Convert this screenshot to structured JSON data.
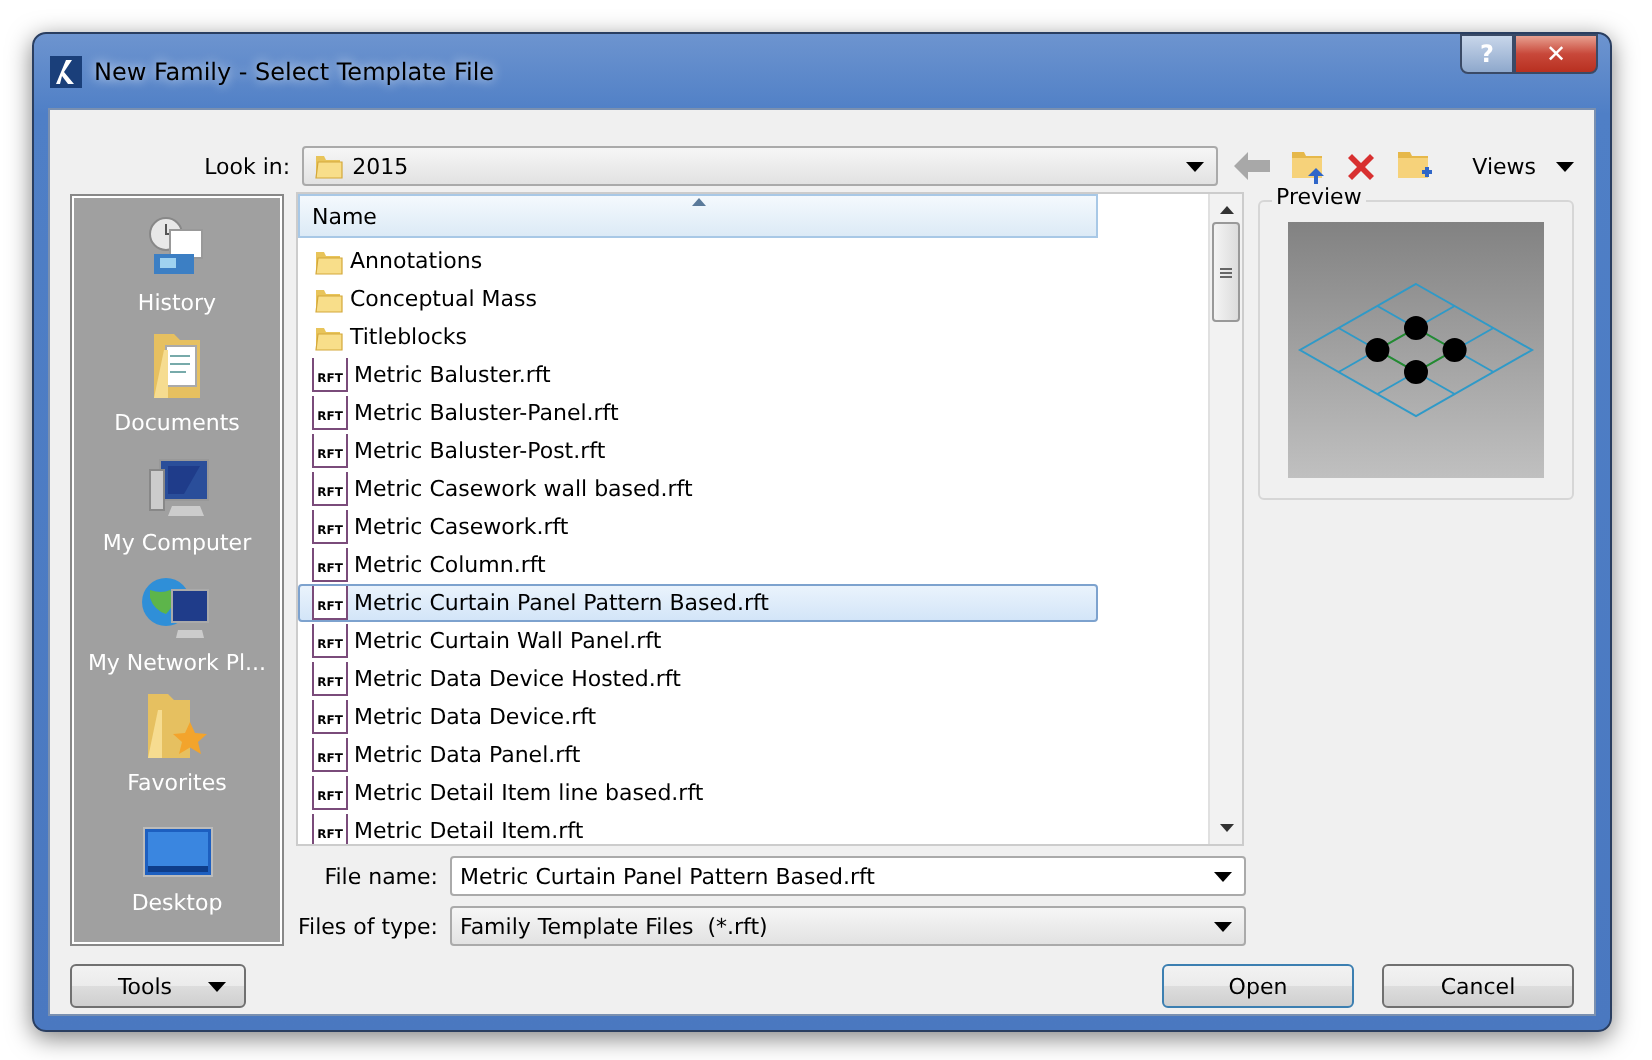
{
  "window": {
    "title": "New Family - Select Template File"
  },
  "title_buttons": [
    {
      "label": "?",
      "kind": "help"
    },
    {
      "label": "✕",
      "kind": "close"
    }
  ],
  "look_in": {
    "label": "Look in:",
    "value": "2015"
  },
  "toolbar": {
    "views_label": "Views"
  },
  "places": [
    {
      "label": "History",
      "kind": "history"
    },
    {
      "label": "Documents",
      "kind": "documents"
    },
    {
      "label": "My Computer",
      "kind": "computer"
    },
    {
      "label": "My Network Pl...",
      "kind": "network"
    },
    {
      "label": "Favorites",
      "kind": "favorites"
    },
    {
      "label": "Desktop",
      "kind": "desktop"
    }
  ],
  "file_list": {
    "column": "Name",
    "items": [
      {
        "name": "Annotations",
        "kind": "folder",
        "selected": false
      },
      {
        "name": "Conceptual Mass",
        "kind": "folder",
        "selected": false
      },
      {
        "name": "Titleblocks",
        "kind": "folder",
        "selected": false
      },
      {
        "name": "Metric Baluster.rft",
        "kind": "file",
        "icon_text": "RFT",
        "selected": false
      },
      {
        "name": "Metric Baluster-Panel.rft",
        "kind": "file",
        "icon_text": "RFT",
        "selected": false
      },
      {
        "name": "Metric Baluster-Post.rft",
        "kind": "file",
        "icon_text": "RFT",
        "selected": false
      },
      {
        "name": "Metric Casework wall based.rft",
        "kind": "file",
        "icon_text": "RFT",
        "selected": false
      },
      {
        "name": "Metric Casework.rft",
        "kind": "file",
        "icon_text": "RFT",
        "selected": false
      },
      {
        "name": "Metric Column.rft",
        "kind": "file",
        "icon_text": "RFT",
        "selected": false
      },
      {
        "name": "Metric Curtain Panel Pattern Based.rft",
        "kind": "file",
        "icon_text": "RFT",
        "selected": true
      },
      {
        "name": "Metric Curtain Wall Panel.rft",
        "kind": "file",
        "icon_text": "RFT",
        "selected": false
      },
      {
        "name": "Metric Data Device Hosted.rft",
        "kind": "file",
        "icon_text": "RFT",
        "selected": false
      },
      {
        "name": "Metric Data Device.rft",
        "kind": "file",
        "icon_text": "RFT",
        "selected": false
      },
      {
        "name": "Metric Data Panel.rft",
        "kind": "file",
        "icon_text": "RFT",
        "selected": false
      },
      {
        "name": "Metric Detail Item line based.rft",
        "kind": "file",
        "icon_text": "RFT",
        "selected": false
      },
      {
        "name": "Metric Detail Item.rft",
        "kind": "file",
        "icon_text": "RFT",
        "selected": false
      }
    ]
  },
  "preview": {
    "label": "Preview"
  },
  "file_name": {
    "label": "File name:",
    "value": "Metric Curtain Panel Pattern Based.rft"
  },
  "file_type": {
    "label": "Files of type:",
    "value": "Family Template Files  (*.rft)"
  },
  "buttons": [
    {
      "label": "Tools",
      "kind": "menu"
    },
    {
      "label": "Open",
      "kind": "default"
    },
    {
      "label": "Cancel",
      "kind": "plain"
    }
  ]
}
